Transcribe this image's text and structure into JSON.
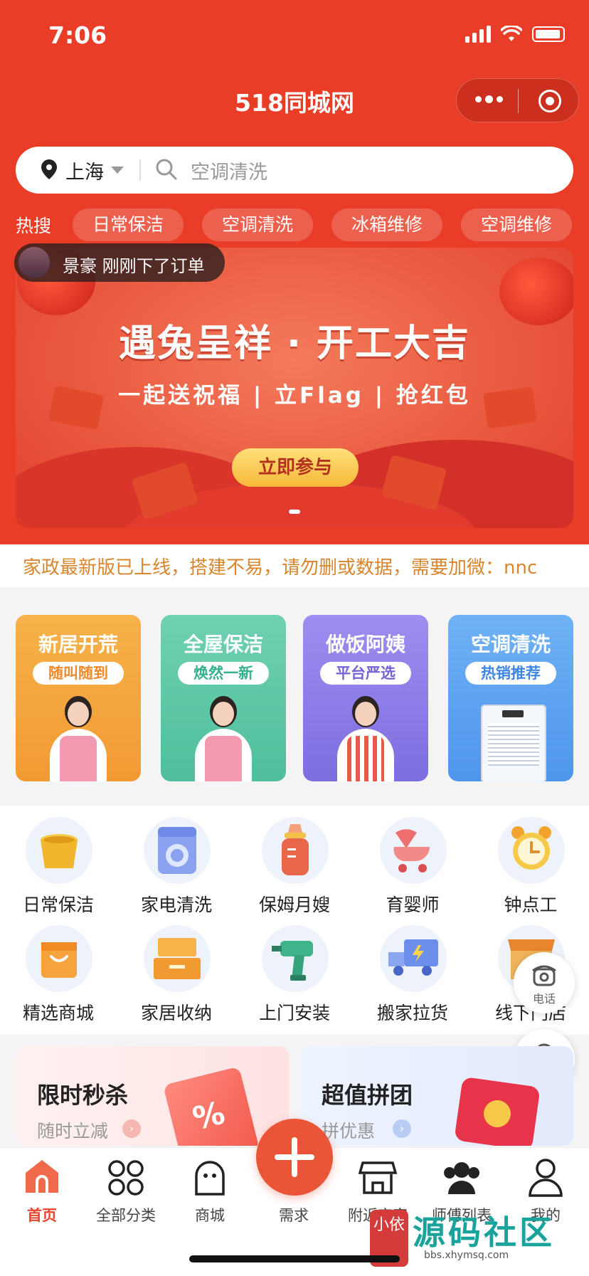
{
  "status": {
    "time": "7:06"
  },
  "app": {
    "title": "518同城网"
  },
  "search": {
    "city": "上海",
    "placeholder": "空调清洗"
  },
  "hot": {
    "label": "热搜",
    "chips": [
      "日常保洁",
      "空调清洗",
      "冰箱维修",
      "空调维修"
    ]
  },
  "toast": {
    "text": "景豪 刚刚下了订单"
  },
  "banner": {
    "title": "遇兔呈祥 · 开工大吉",
    "subtitle": "一起送祝福 | 立Flag | 抢红包",
    "button": "立即参与"
  },
  "marquee": {
    "text": "家政最新版已上线，搭建不易，请勿删或数据，需要加微：nnc"
  },
  "cards": [
    {
      "title": "新居开荒",
      "badge": "随叫随到",
      "color": "#f5a33c",
      "badge_color": "#f0892a"
    },
    {
      "title": "全屋保洁",
      "badge": "焕然一新",
      "color": "#5cc7a7",
      "badge_color": "#35b08e"
    },
    {
      "title": "做饭阿姨",
      "badge": "平台严选",
      "color": "#8e7ee6",
      "badge_color": "#7464d8"
    },
    {
      "title": "空调清洗",
      "badge": "热销推荐",
      "color": "#5e9ff0",
      "badge_color": "#3f86e6"
    }
  ],
  "grid": [
    {
      "label": "日常保洁",
      "icon": "bucket-icon"
    },
    {
      "label": "家电清洗",
      "icon": "washing-machine-icon"
    },
    {
      "label": "保姆月嫂",
      "icon": "baby-bottle-icon"
    },
    {
      "label": "育婴师",
      "icon": "stroller-icon"
    },
    {
      "label": "钟点工",
      "icon": "alarm-clock-icon"
    },
    {
      "label": "精选商城",
      "icon": "shopping-bag-icon"
    },
    {
      "label": "家居收纳",
      "icon": "storage-box-icon"
    },
    {
      "label": "上门安装",
      "icon": "drill-icon"
    },
    {
      "label": "搬家拉货",
      "icon": "truck-icon"
    },
    {
      "label": "线下门店",
      "icon": "store-icon"
    }
  ],
  "float": {
    "phone": "电话",
    "service": "客服"
  },
  "promos": [
    {
      "title": "限时秒杀",
      "sub": "随时立减"
    },
    {
      "title": "超值拼团",
      "sub": "拼优惠"
    }
  ],
  "tabs": [
    {
      "label": "首页",
      "icon": "home-icon"
    },
    {
      "label": "全部分类",
      "icon": "grid-icon"
    },
    {
      "label": "商城",
      "icon": "shop-face-icon"
    },
    {
      "label": "需求",
      "icon": "plus-icon"
    },
    {
      "label": "附近商家",
      "icon": "storefront-icon"
    },
    {
      "label": "师傅列表",
      "icon": "workers-icon"
    },
    {
      "label": "我的",
      "icon": "user-icon"
    }
  ],
  "watermark": {
    "title": "源码社区",
    "url": "bbs.xhymsq.com",
    "seal": "小依"
  },
  "colors": {
    "brand": "#ea3d28",
    "accent": "#ea5538",
    "marquee": "#d9852c"
  }
}
